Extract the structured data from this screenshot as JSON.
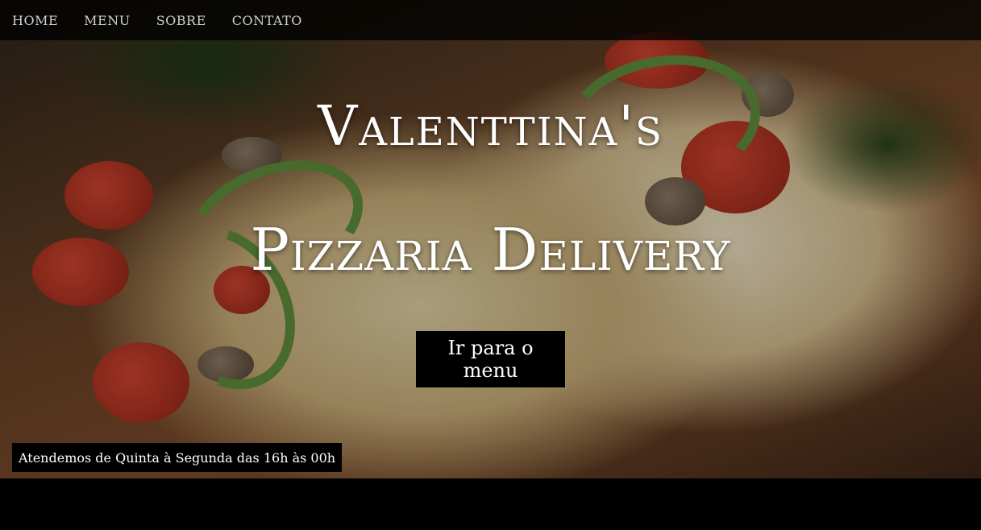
{
  "nav": {
    "items": [
      {
        "label": "HOME"
      },
      {
        "label": "MENU"
      },
      {
        "label": "SOBRE"
      },
      {
        "label": "CONTATO"
      }
    ]
  },
  "hero": {
    "title_line1": "Valenttina's",
    "title_line2": "Pizzaria Delivery",
    "cta_label": "Ir para o menu",
    "hours_text": "Atendemos de Quinta à Segunda das 16h às 00h"
  }
}
